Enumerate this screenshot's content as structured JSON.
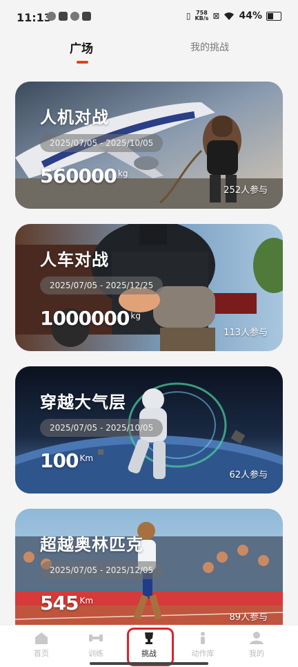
{
  "status_bar": {
    "time": "11:13",
    "speed_value": "758",
    "speed_unit": "KB/s",
    "battery": "44%"
  },
  "tabs": {
    "plaza": "广场",
    "mine": "我的挑战"
  },
  "cards": [
    {
      "title": "人机对战",
      "date": "2025/07/05 - 2025/10/05",
      "value": "560000",
      "unit": "kg",
      "participants": "252人参与"
    },
    {
      "title": "人车对战",
      "date": "2025/07/05 - 2025/12/25",
      "value": "1000000",
      "unit": "kg",
      "participants": "113人参与"
    },
    {
      "title": "穿越大气层",
      "date": "2025/07/05 - 2025/10/05",
      "value": "100",
      "unit": "Km",
      "participants": "62人参与"
    },
    {
      "title": "超越奥林匹克",
      "date": "2025/07/05 - 2025/12/05",
      "value": "545",
      "unit": "Km",
      "participants": "89人参与"
    }
  ],
  "bottom_nav": [
    {
      "label": "首页",
      "icon": "home-icon"
    },
    {
      "label": "训练",
      "icon": "dumbbell-icon"
    },
    {
      "label": "挑战",
      "icon": "trophy-icon"
    },
    {
      "label": "动作库",
      "icon": "exercise-library-icon"
    },
    {
      "label": "我的",
      "icon": "profile-icon"
    }
  ],
  "colors": {
    "accent": "#e0401f",
    "highlight_border": "#e0202a"
  }
}
